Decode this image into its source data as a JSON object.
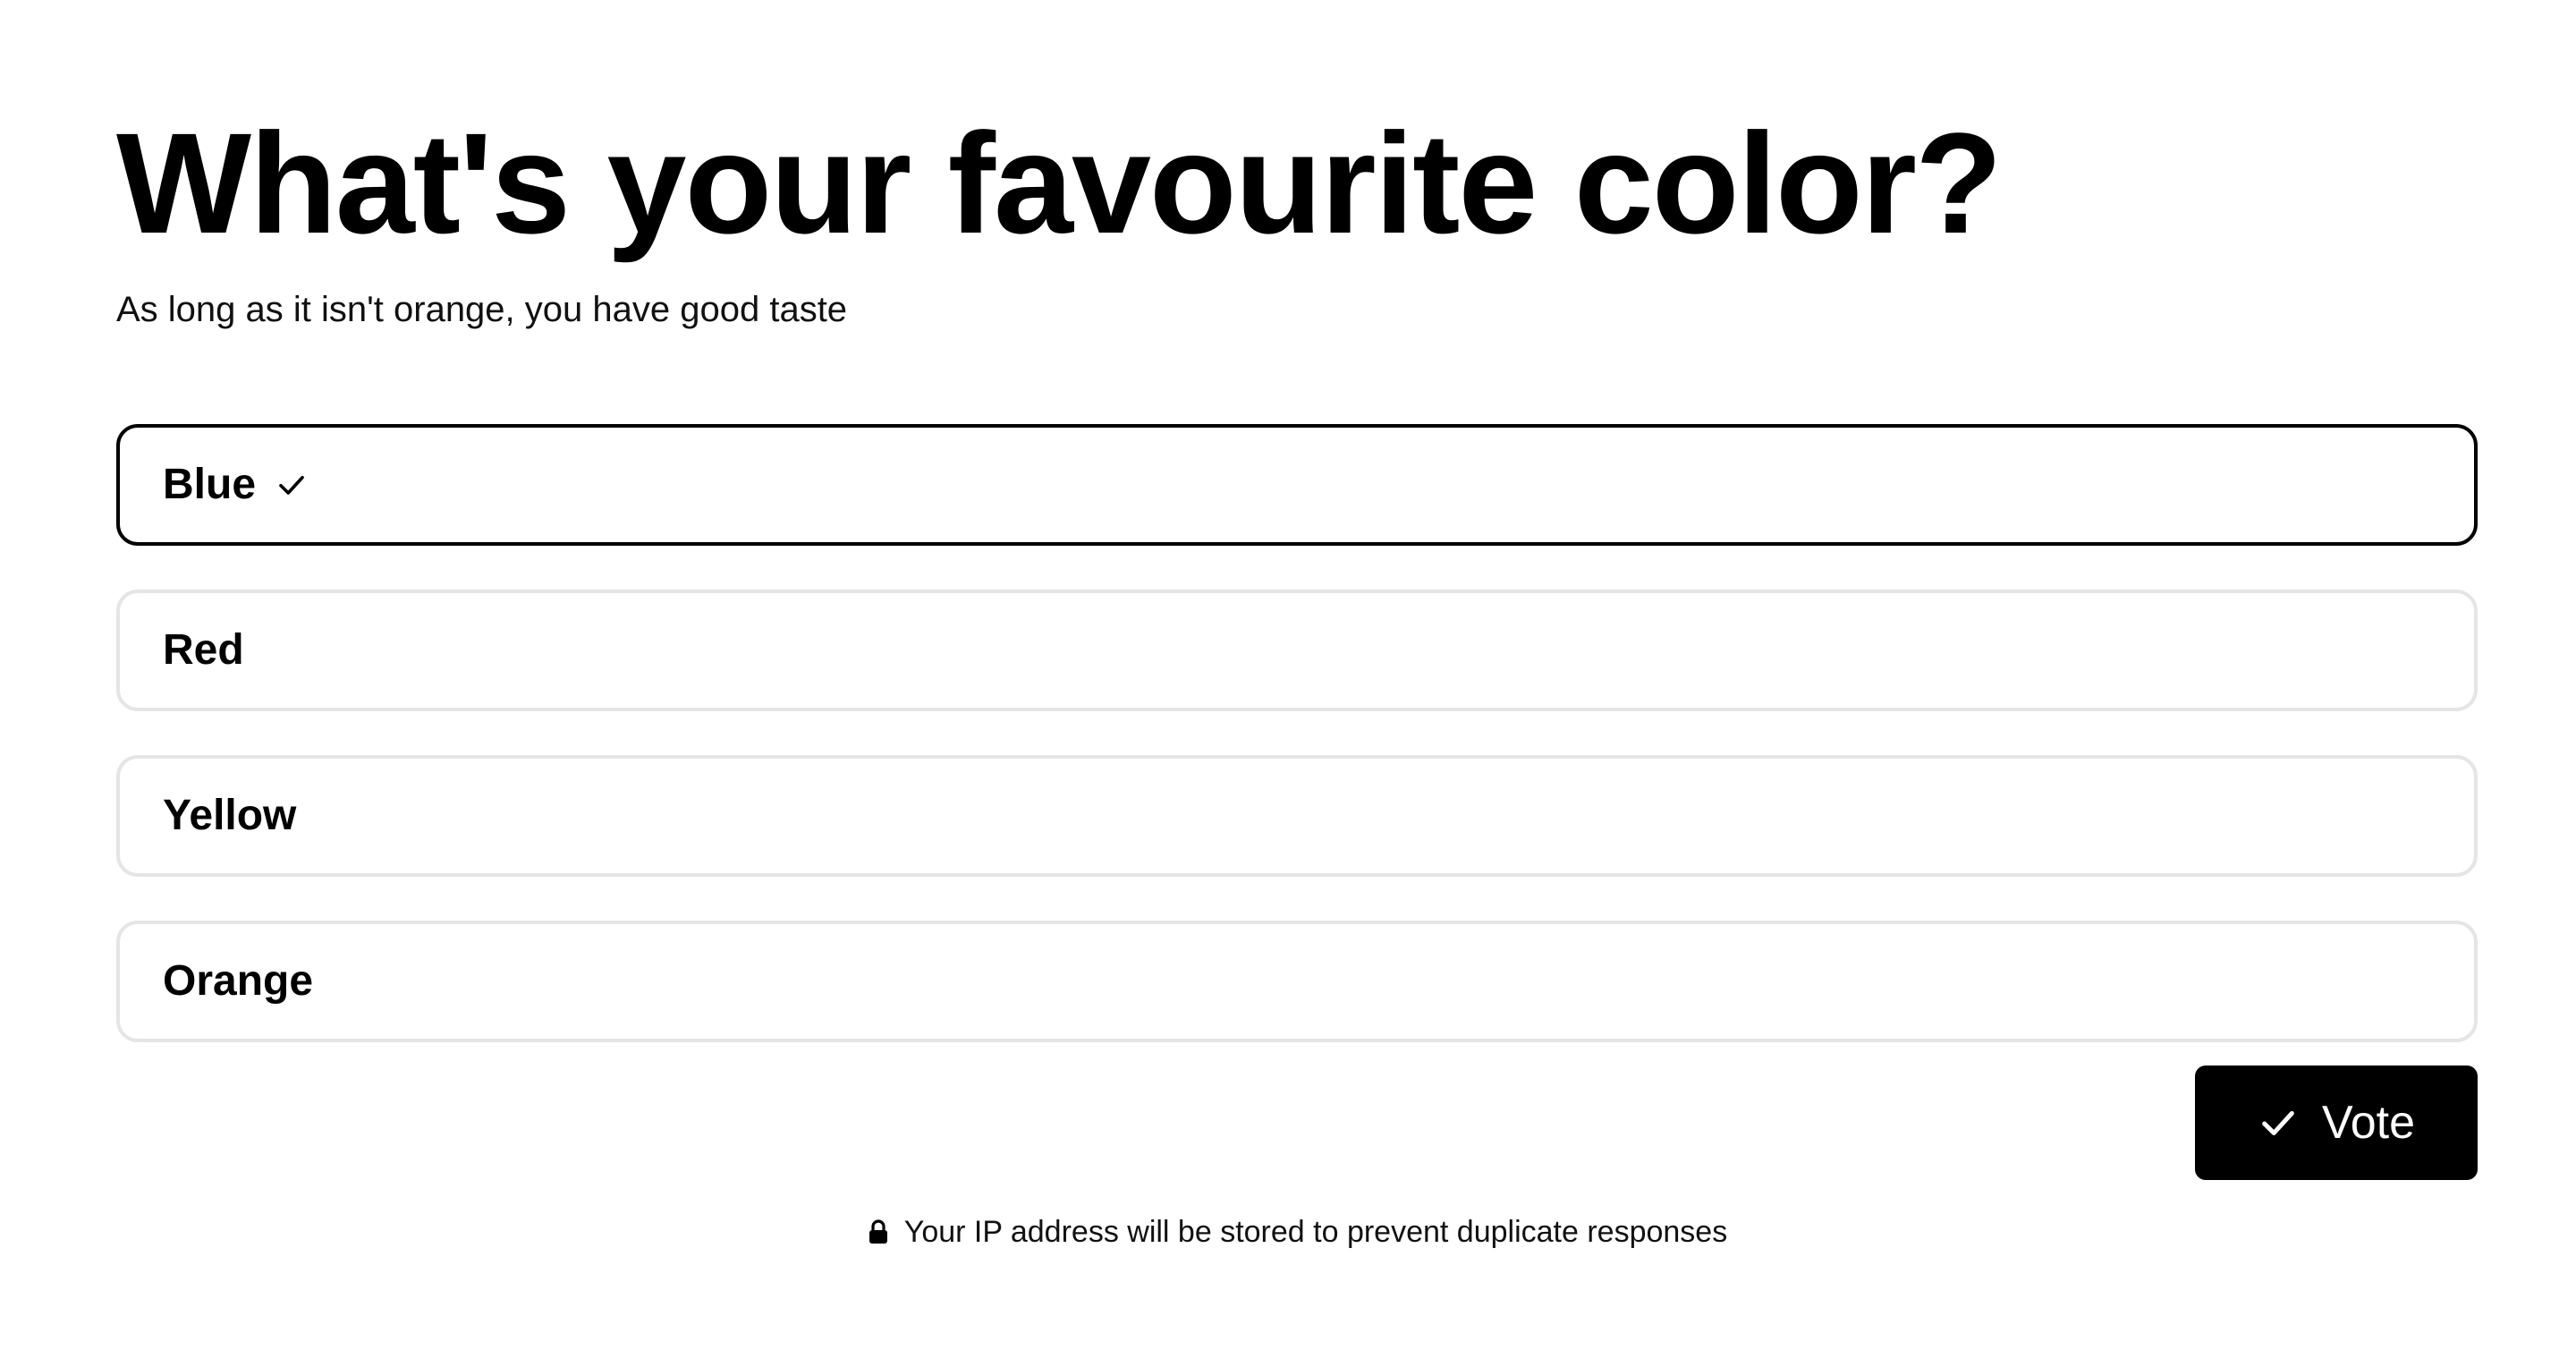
{
  "poll": {
    "title": "What's your favourite color?",
    "subtitle": "As long as it isn't orange, you have good taste",
    "options": [
      {
        "label": "Blue",
        "selected": true
      },
      {
        "label": "Red",
        "selected": false
      },
      {
        "label": "Yellow",
        "selected": false
      },
      {
        "label": "Orange",
        "selected": false
      }
    ],
    "vote_label": "Vote",
    "notice": "Your IP address will be stored to prevent duplicate responses"
  },
  "icons": {
    "selected_check": "check-icon",
    "vote_button": "check-icon",
    "notice": "lock-icon"
  },
  "colors": {
    "background": "#ffffff",
    "text": "#000000",
    "option_border": "#e5e5e5",
    "option_border_selected": "#000000",
    "button_background": "#000000",
    "button_text": "#ffffff"
  }
}
